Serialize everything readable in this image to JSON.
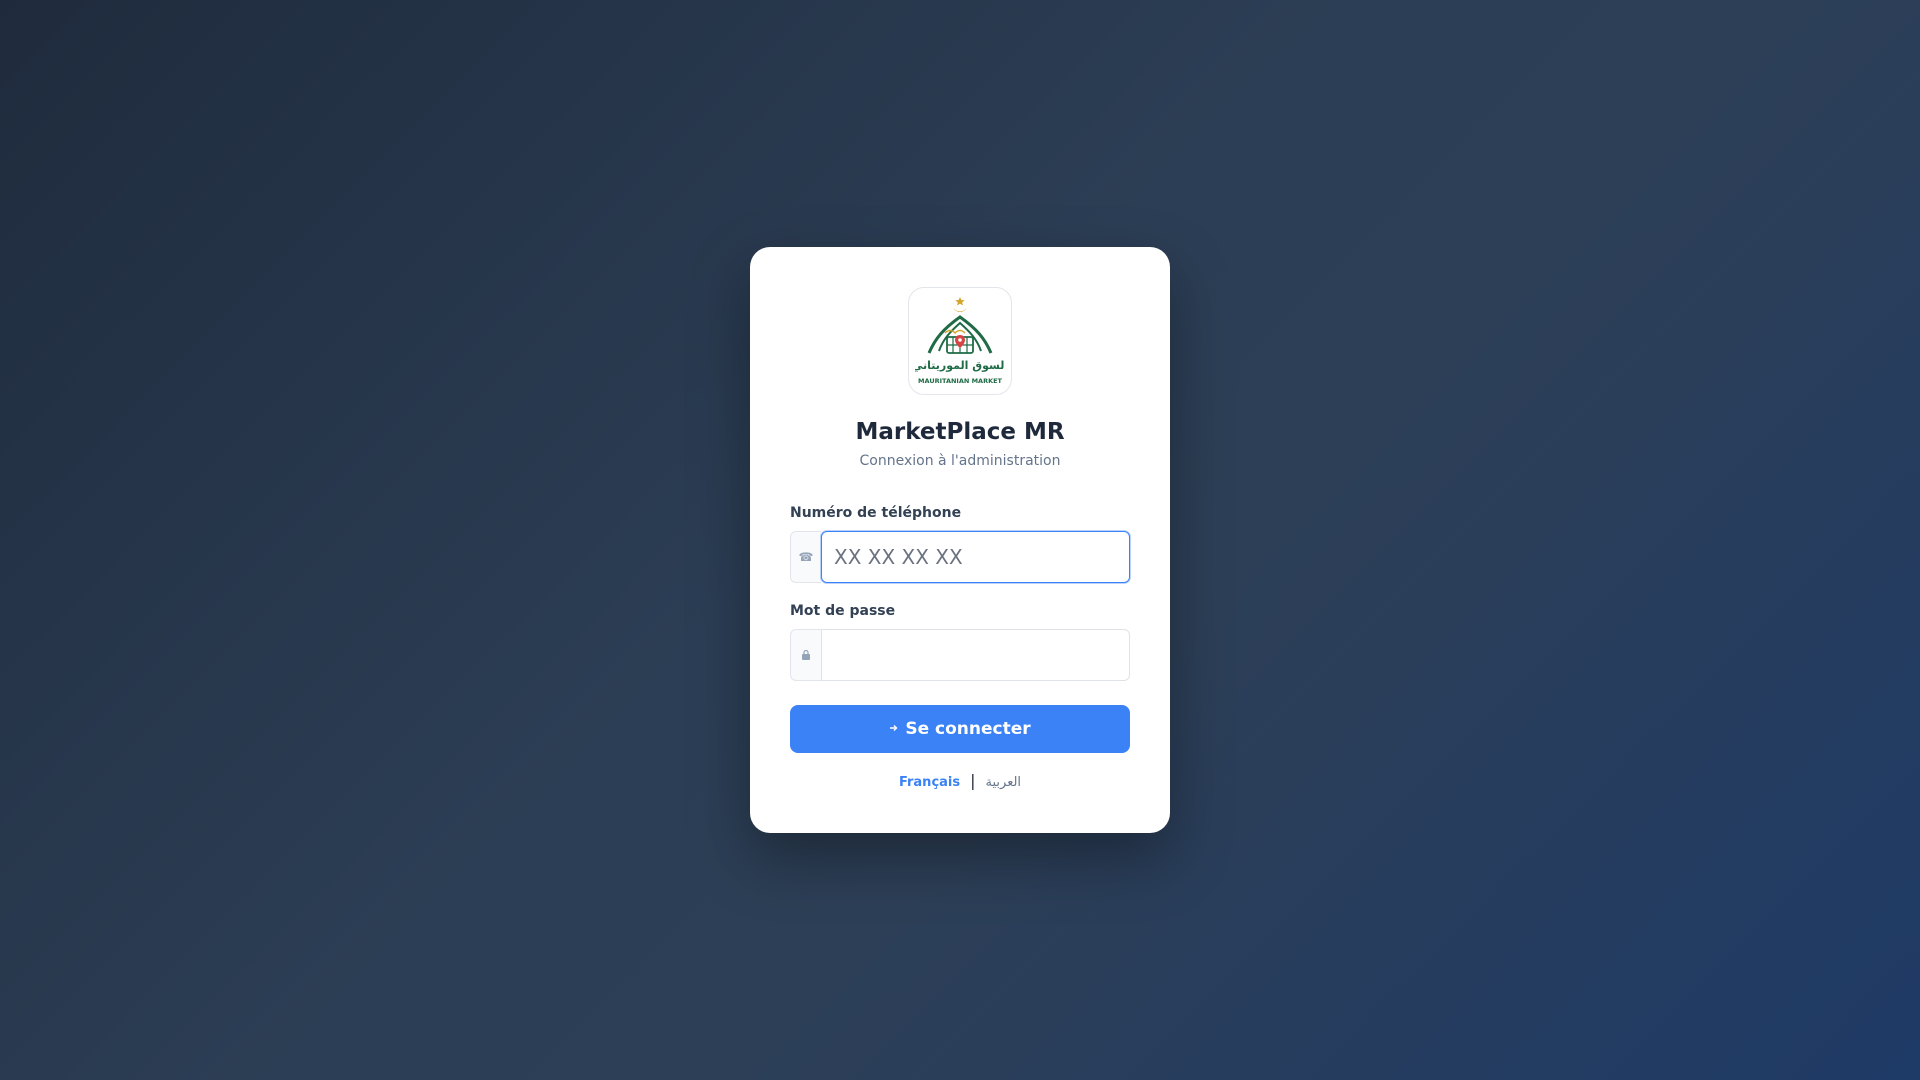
{
  "brand": {
    "name": "MarketPlace MR",
    "subtitle": "Connexion à l'administration",
    "logo": {
      "arabic_text": "السوق الموريتاني",
      "english_text": "MAURITANIAN MARKET"
    }
  },
  "form": {
    "phone": {
      "label": "Numéro de téléphone",
      "placeholder": "XX XX XX XX",
      "value": "",
      "icon": "phone-icon"
    },
    "password": {
      "label": "Mot de passe",
      "placeholder": "",
      "value": "",
      "icon": "lock-icon"
    },
    "submit_label": "Se connecter",
    "submit_icon": "login-icon"
  },
  "languages": {
    "active": "Français",
    "separator": "|",
    "other": "العربية"
  },
  "colors": {
    "accent": "#3b82f6",
    "logo_green": "#1f6b45",
    "logo_gold": "#d4a72c",
    "logo_red": "#d64545"
  }
}
